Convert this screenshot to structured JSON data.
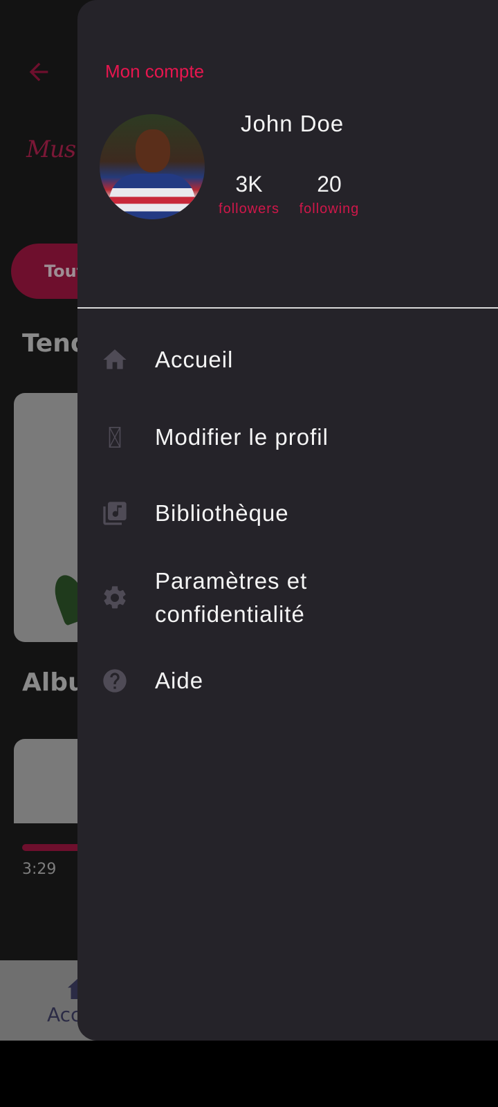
{
  "background_app": {
    "logo_text": "Mus",
    "chip_label": "Tout",
    "section_trending": "Tend",
    "section_albums": "Albu",
    "time": "3:29",
    "bottom_nav_label": "Acc"
  },
  "drawer": {
    "title": "Mon compte",
    "user": {
      "name": "John Doe",
      "followers_count": "3K",
      "followers_label": "followers",
      "following_count": "20",
      "following_label": "following"
    },
    "menu": [
      {
        "label": "Accueil",
        "icon": "home-icon"
      },
      {
        "label": "Modifier le profil",
        "icon": "broken-image-icon"
      },
      {
        "label": "Bibliothèque",
        "icon": "library-music-icon"
      },
      {
        "label": "Paramètres et confidentialité",
        "icon": "gear-icon"
      },
      {
        "label": "Aide",
        "icon": "help-icon"
      }
    ]
  },
  "colors": {
    "accent": "#e8164f",
    "drawer_bg": "#252329",
    "icon": "#4f4b56",
    "text": "#f5f5f5"
  }
}
